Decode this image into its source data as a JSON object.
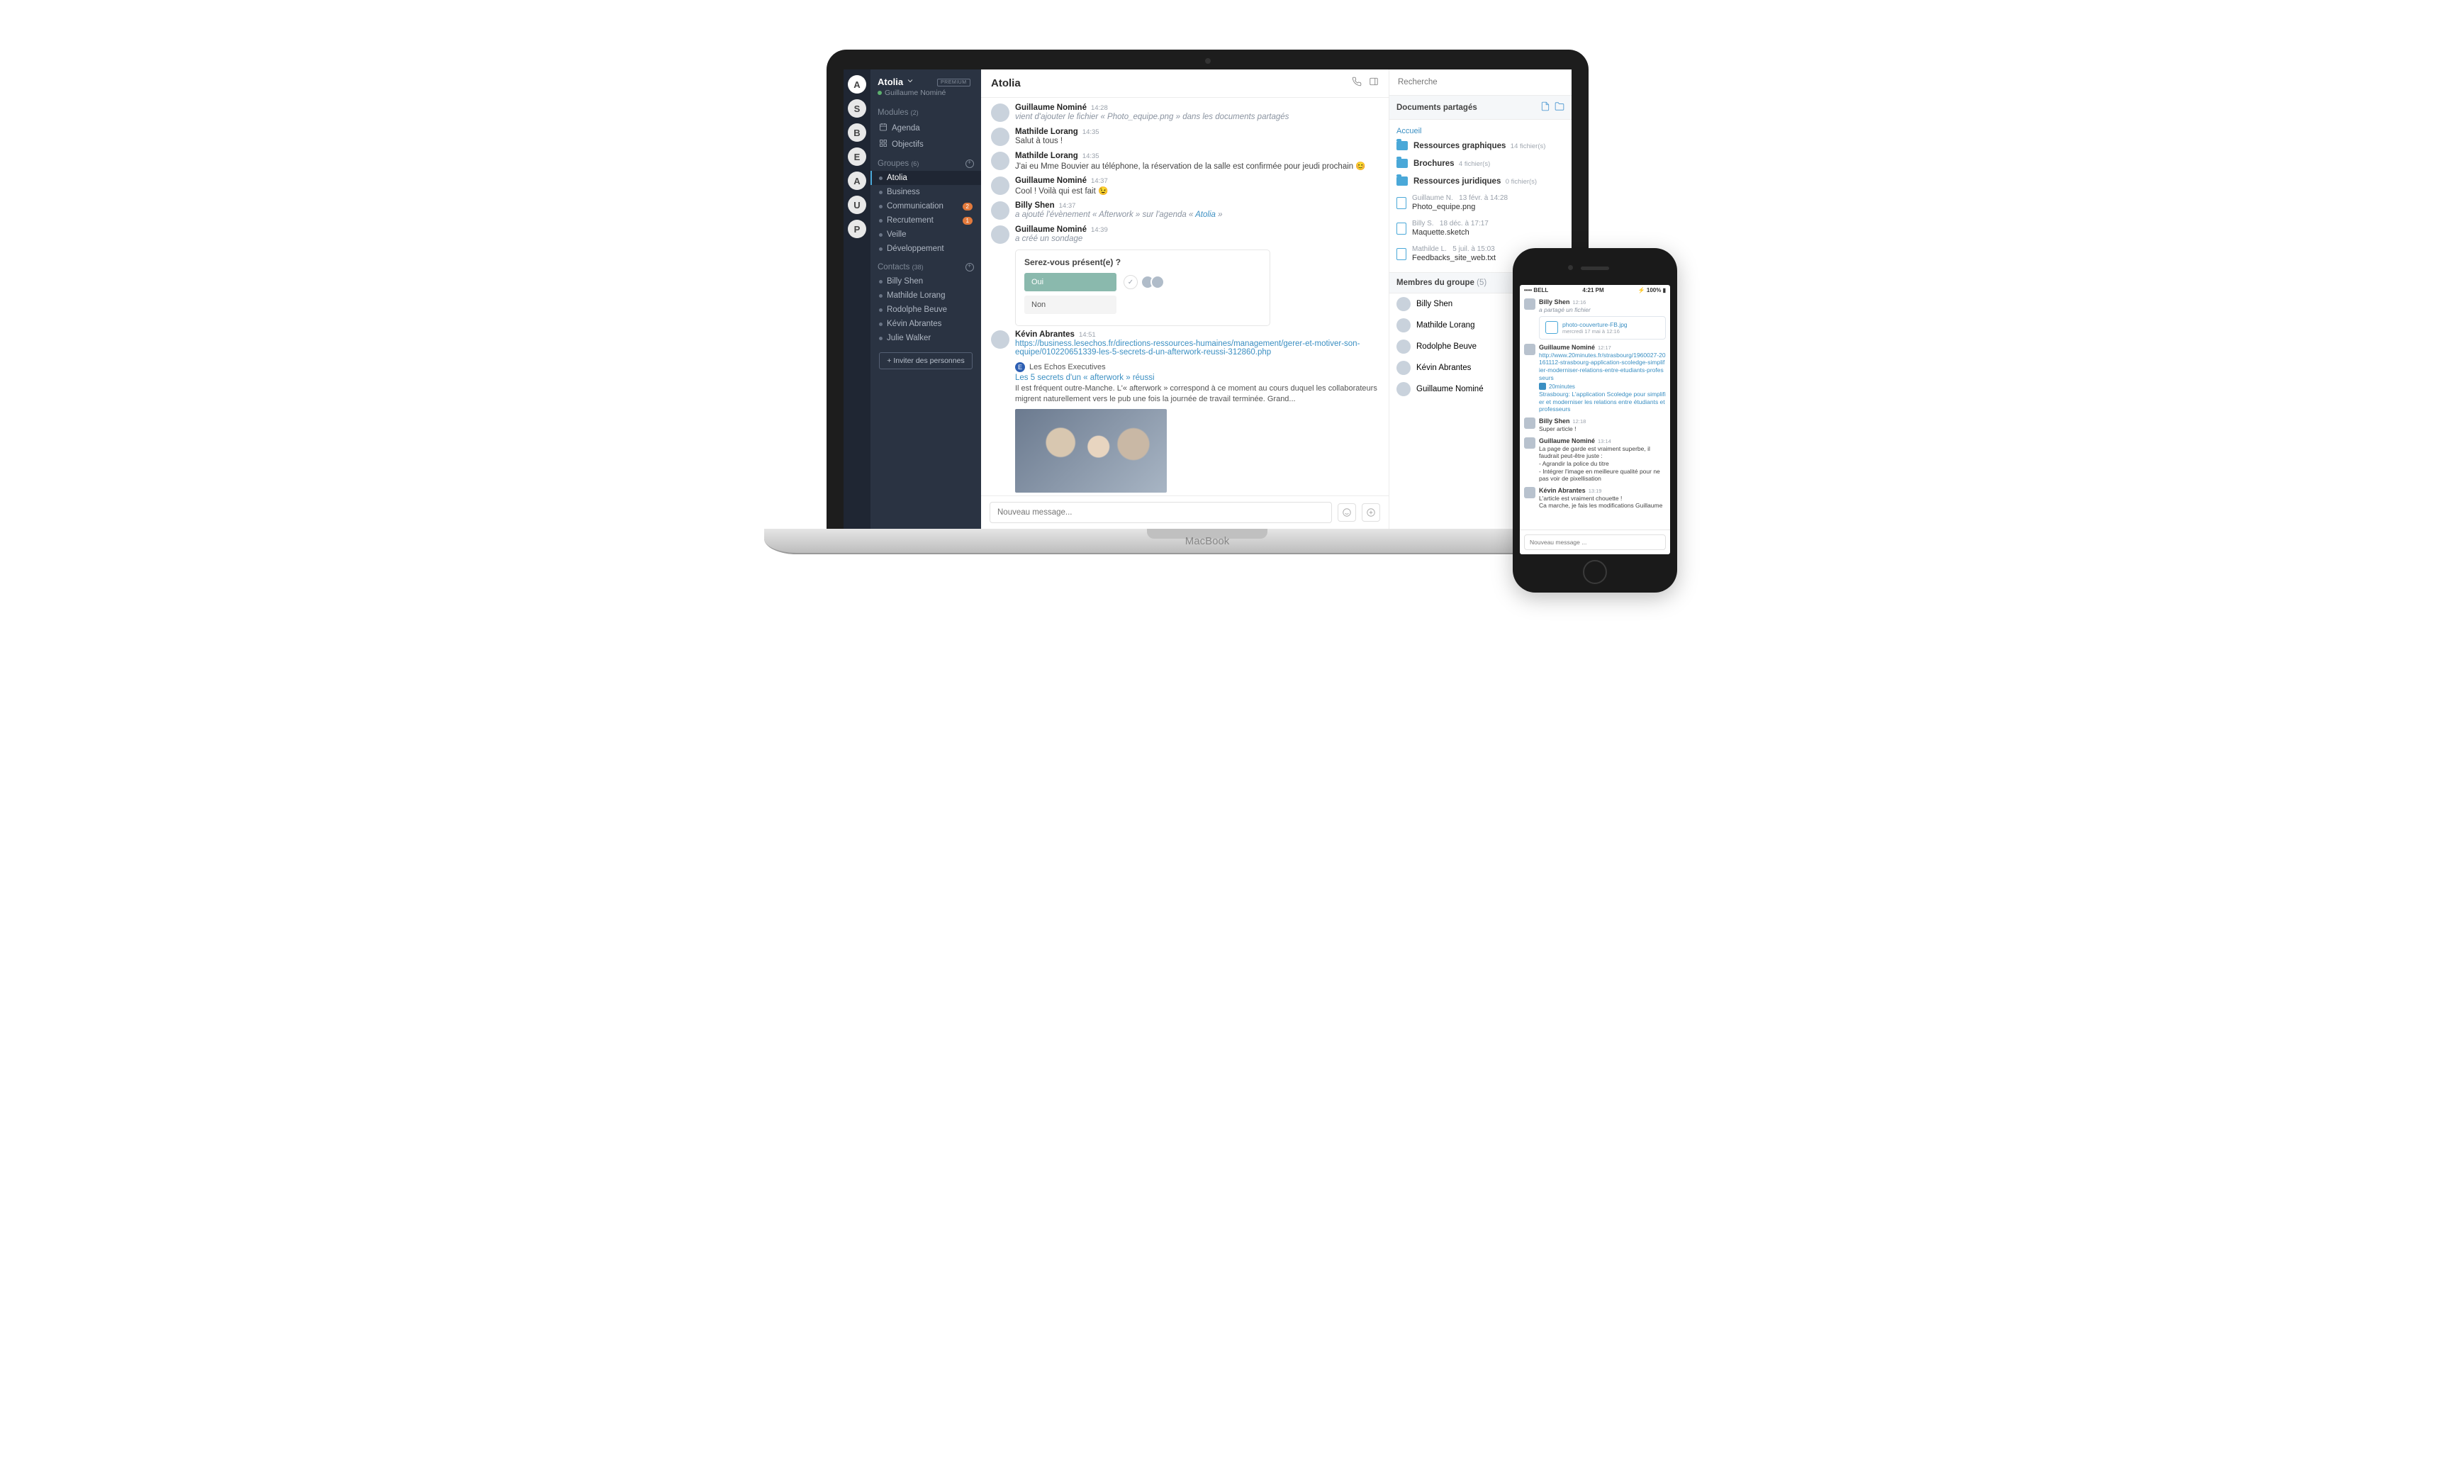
{
  "macbook_brand": "MacBook",
  "rail": {
    "letters": [
      "A",
      "S",
      "B",
      "E",
      "A",
      "U",
      "P"
    ]
  },
  "sidebar": {
    "team": "Atolia",
    "user": "Guillaume Nominé",
    "premium": "PREMIUM",
    "modules_label": "Modules",
    "modules_count": "(2)",
    "modules": [
      {
        "label": "Agenda"
      },
      {
        "label": "Objectifs"
      }
    ],
    "groups_label": "Groupes",
    "groups_count": "(6)",
    "groups": [
      {
        "label": "Atolia",
        "active": true
      },
      {
        "label": "Business"
      },
      {
        "label": "Communication",
        "badge": "2"
      },
      {
        "label": "Recrutement",
        "badge": "1"
      },
      {
        "label": "Veille"
      },
      {
        "label": "Développement"
      }
    ],
    "contacts_label": "Contacts",
    "contacts_count": "(38)",
    "contacts": [
      {
        "label": "Billy Shen"
      },
      {
        "label": "Mathilde Lorang"
      },
      {
        "label": "Rodolphe Beuve"
      },
      {
        "label": "Kévin Abrantes"
      },
      {
        "label": "Julie Walker"
      }
    ],
    "invite": "+ Inviter des personnes"
  },
  "chat": {
    "title": "Atolia",
    "messages": [
      {
        "author": "Guillaume Nominé",
        "time": "14:28",
        "system": "vient d'ajouter le fichier « Photo_equipe.png » dans les documents partagés"
      },
      {
        "author": "Mathilde Lorang",
        "time": "14:35",
        "text": "Salut à tous !"
      },
      {
        "author": "Mathilde Lorang",
        "time": "14:35",
        "text": "J'ai eu Mme Bouvier au téléphone, la réservation de la salle est confirmée pour jeudi prochain 😊"
      },
      {
        "author": "Guillaume Nominé",
        "time": "14:37",
        "text": "Cool ! Voilà qui est fait 😉"
      },
      {
        "author": "Billy Shen",
        "time": "14:37",
        "system_prefix": "a ajouté l'évènement « Afterwork » sur l'agenda «",
        "system_link": "Atolia",
        "system_suffix": " »"
      },
      {
        "author": "Guillaume Nominé",
        "time": "14:39",
        "system": "a créé un sondage"
      }
    ],
    "poll": {
      "question": "Serez-vous présent(e) ?",
      "options": [
        {
          "label": "Oui",
          "selected": true
        },
        {
          "label": "Non",
          "selected": false
        }
      ]
    },
    "link_msg": {
      "author": "Kévin Abrantes",
      "time": "14:51",
      "url": "https://business.lesechos.fr/directions-ressources-humaines/management/gerer-et-motiver-son-equipe/010220651339-les-5-secrets-d-un-afterwork-reussi-312860.php",
      "source": "Les Echos Executives",
      "title": "Les 5 secrets d'un « afterwork » réussi",
      "desc": "Il est fréquent outre-Manche. L'« afterwork » correspond à ce moment au cours duquel les collaborateurs migrent naturellement vers le pub une fois la journée de travail terminée. Grand..."
    },
    "composer_placeholder": "Nouveau message..."
  },
  "rpanel": {
    "search_placeholder": "Recherche",
    "docs_title": "Documents partagés",
    "breadcrumb": "Accueil",
    "folders": [
      {
        "name": "Ressources graphiques",
        "meta": "14 fichier(s)"
      },
      {
        "name": "Brochures",
        "meta": "4 fichier(s)"
      },
      {
        "name": "Ressources juridiques",
        "meta": "0 fichier(s)"
      }
    ],
    "files": [
      {
        "owner": "Guillaume N.",
        "date": "13 févr. à 14:28",
        "name": "Photo_equipe.png"
      },
      {
        "owner": "Billy S.",
        "date": "18 déc. à 17:17",
        "name": "Maquette.sketch"
      },
      {
        "owner": "Mathilde L.",
        "date": "5 juil. à 15:03",
        "name": "Feedbacks_site_web.txt"
      }
    ],
    "members_title": "Membres du groupe",
    "members_count": "(5)",
    "members": [
      "Billy Shen",
      "Mathilde Lorang",
      "Rodolphe Beuve",
      "Kévin Abrantes",
      "Guillaume Nominé"
    ]
  },
  "iphone": {
    "status": {
      "carrier": "•••• BELL",
      "time": "4:21 PM",
      "battery": "100%"
    },
    "messages": [
      {
        "author": "Billy Shen",
        "time": "12:16",
        "system": "a partagé un fichier",
        "file": {
          "name": "photo-couverture-FB.jpg",
          "date": "mercredi 17 mai à 12:16"
        }
      },
      {
        "author": "Guillaume Nominé",
        "time": "12:17",
        "url": "http://www.20minutes.fr/strasbourg/1960027-20161112-strasbourg-application-scoledge-simplifier-moderniser-relations-entre-etudiants-professeurs",
        "source": "20minutes",
        "link_title": "Strasbourg: L'application Scoledge pour simplifier et moderniser les relations entre étudiants et professeurs"
      },
      {
        "author": "Billy Shen",
        "time": "12:18",
        "text": "Super article !"
      },
      {
        "author": "Guillaume Nominé",
        "time": "13:14",
        "text": "La page de garde est vraiment superbe, il faudrait peut-être juste :\n- Agrandir la police du titre\n- Intégrer l'image en meilleure qualité pour ne pas voir de pixellisation"
      },
      {
        "author": "Kévin Abrantes",
        "time": "13:19",
        "text": "L'article est vraiment chouette !\nCa marche, je fais les modifications Guillaume"
      }
    ],
    "composer_placeholder": "Nouveau message ..."
  }
}
